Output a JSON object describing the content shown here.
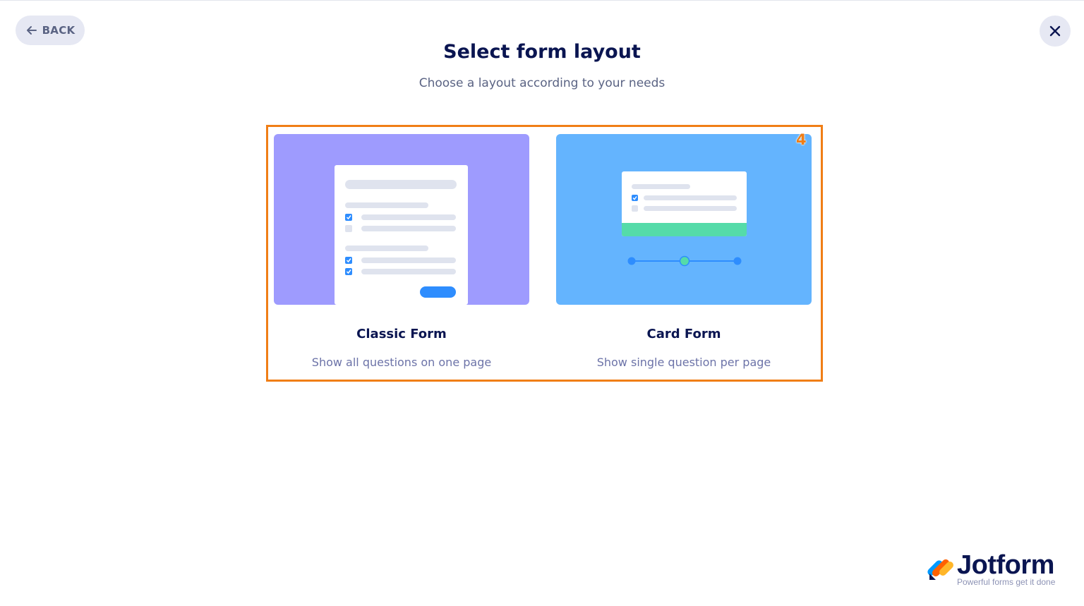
{
  "header": {
    "back_label": "BACK",
    "title": "Select form layout",
    "subtitle": "Choose a layout according to your needs"
  },
  "annotation": {
    "marker": "4",
    "color": "#f07e16"
  },
  "options": [
    {
      "title": "Classic Form",
      "description": "Show all questions on one page",
      "thumbnail_color": "#9e9bfe"
    },
    {
      "title": "Card Form",
      "description": "Show single question per page",
      "thumbnail_color": "#64b4fe"
    }
  ],
  "brand": {
    "name": "Jotform",
    "tagline": "Powerful forms get it done"
  },
  "colors": {
    "primary_text": "#0a1551",
    "secondary_text": "#6c73a8",
    "button_bg": "#e6e8f3",
    "accent_blue": "#2e8dfe",
    "accent_green": "#55dba9"
  },
  "icons": {
    "back": "arrow-left-icon",
    "close": "close-icon",
    "logo": "jotform-logo-icon"
  }
}
